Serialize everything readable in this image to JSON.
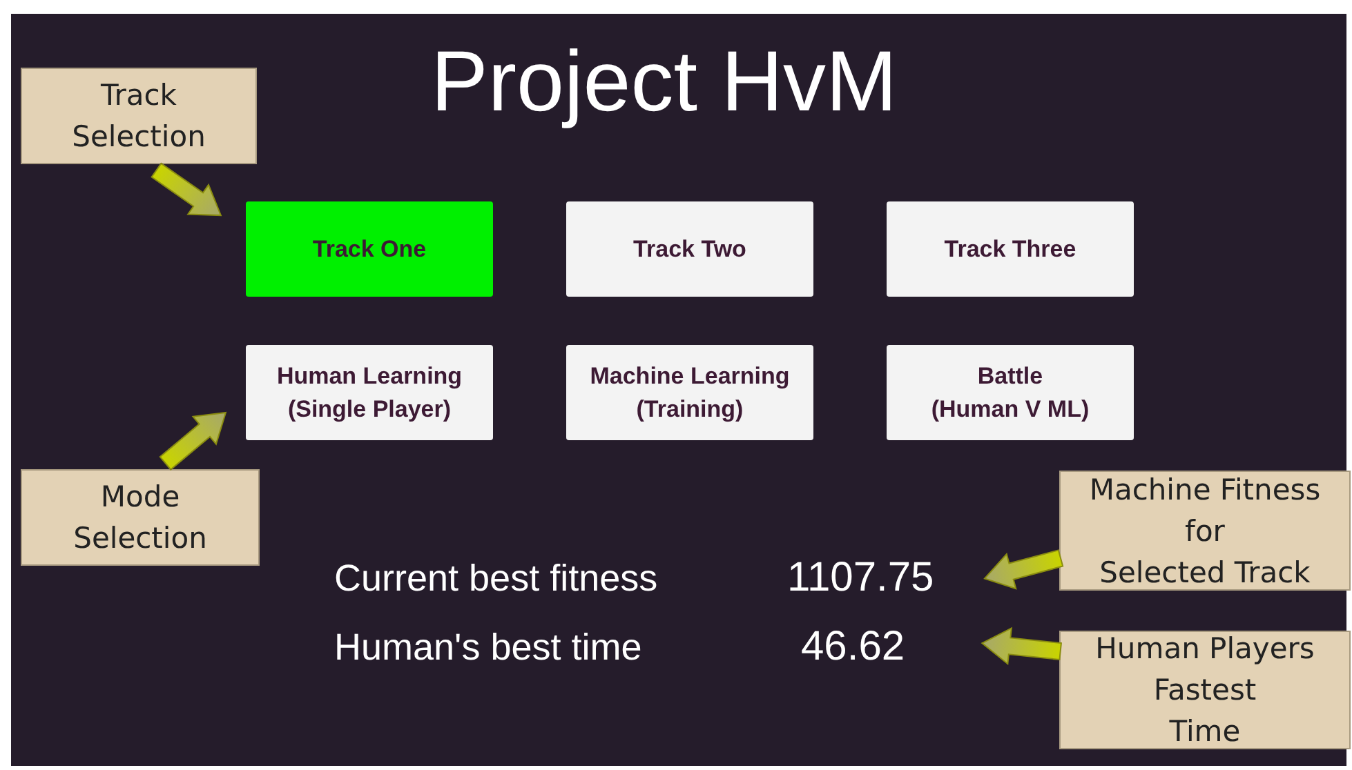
{
  "title": "Project HvM",
  "tracks": [
    {
      "label": "Track One",
      "selected": true
    },
    {
      "label": "Track Two",
      "selected": false
    },
    {
      "label": "Track Three",
      "selected": false
    }
  ],
  "modes": [
    {
      "label": "Human Learning\n(Single Player)"
    },
    {
      "label": "Machine Learning\n(Training)"
    },
    {
      "label": "Battle\n(Human V ML)"
    }
  ],
  "stats": [
    {
      "label": "Current best fitness",
      "value": "1107.75"
    },
    {
      "label": "Human's best time",
      "value": "46.62"
    }
  ],
  "callouts": [
    {
      "text": "Track\nSelection"
    },
    {
      "text": "Mode\nSelection"
    },
    {
      "text": "Machine Fitness\nfor\nSelected Track"
    },
    {
      "text": "Human Players\nFastest\nTime"
    }
  ]
}
